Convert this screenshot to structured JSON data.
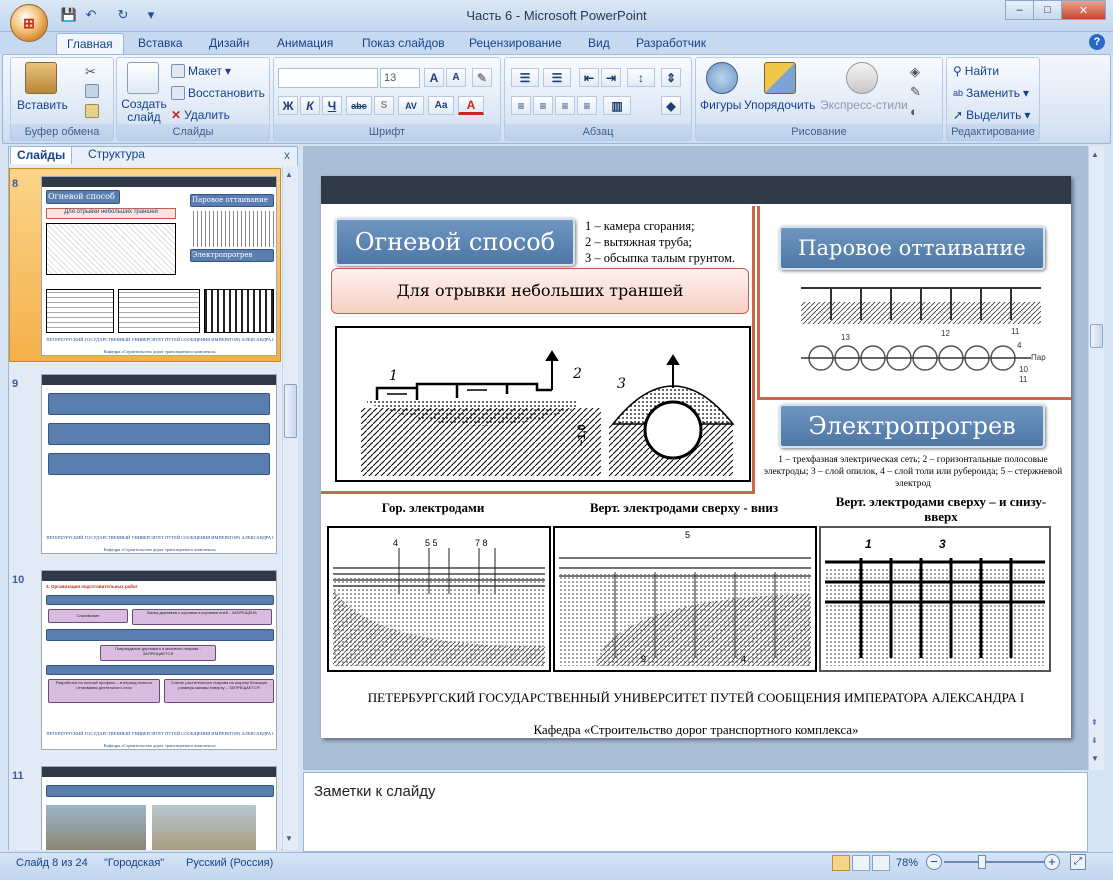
{
  "window": {
    "title": "Часть 6 - Microsoft PowerPoint",
    "min": "–",
    "max": "□",
    "close": "✕"
  },
  "qat": {
    "save": "💾",
    "undo": "↶",
    "redo": "↻",
    "more": "▾"
  },
  "tabs": [
    "Главная",
    "Вставка",
    "Дизайн",
    "Анимация",
    "Показ слайдов",
    "Рецензирование",
    "Вид",
    "Разработчик"
  ],
  "help": "?",
  "ribbon": {
    "clipboard": {
      "label": "Буфер обмена",
      "paste": "Вставить"
    },
    "slides": {
      "label": "Слайды",
      "new": "Создать слайд",
      "layout": "Макет",
      "reset": "Восстановить",
      "delete": "Удалить"
    },
    "font": {
      "label": "Шрифт",
      "size": "13",
      "bold": "Ж",
      "italic": "К",
      "underline": "Ч",
      "strike": "abc",
      "spacing": "AV",
      "case": "Aa"
    },
    "paragraph": {
      "label": "Абзац"
    },
    "drawing": {
      "label": "Рисование",
      "shapes": "Фигуры",
      "arrange": "Упорядочить",
      "quick_styles": "Экспресс-стили"
    },
    "editing": {
      "label": "Редактирование",
      "find": "Найти",
      "replace": "Заменить",
      "select": "Выделить"
    }
  },
  "panel": {
    "tab_slides": "Слайды",
    "tab_outline": "Структура",
    "close": "x"
  },
  "thumbnails": [
    {
      "num": "8"
    },
    {
      "num": "9"
    },
    {
      "num": "10",
      "title": "3. Организация подготовительных работ",
      "pink1": "Спиливание",
      "pink2": "Валка деревьев с корнями и корчевка пней - ЗАПРЕЩЕНА",
      "pink3": "Повреждение дернового и мохового покрова - ЗАПРЕЩАЕТСЯ",
      "pink4": "Разработка на полный профиль – в период полного оттаивания деятельного слоя",
      "pink5": "Снятие растительного покрова на ширину большую размера канавы поверху – ЗАПРЕЩАЕТСЯ"
    },
    {
      "num": "11"
    }
  ],
  "slide": {
    "title_fire": "Огневой способ",
    "fire_legend": [
      "1 – камера сгорания;",
      "2 – вытяжная труба;",
      "3 – обсыпка талым грунтом."
    ],
    "subtitle": "Для отрывки небольших траншей",
    "title_steam": "Паровое оттаивание",
    "title_electric": "Электропрогрев",
    "electric_legend": "1 – трехфазная электрическая сеть; 2 – горизонтальные полосовые электроды; 3 – слой опилок, 4 – слой толи или рубероида; 5 – стержневой электрод",
    "cap1": "Гор. электродами",
    "cap2": "Верт. электродами сверху - вниз",
    "cap3": "Верт. электродами сверху – и снизу-вверх",
    "footer1": "ПЕТЕРБУРГСКИЙ ГОСУДАРСТВЕННЫЙ УНИВЕРСИТЕТ ПУТЕЙ СООБЩЕНИЯ ИМПЕРАТОРА АЛЕКСАНДРА I",
    "footer2": "Кафедра «Строительство дорог транспортного комплекса»",
    "fire_labels": [
      "1",
      "2",
      "3"
    ],
    "steam_labels": [
      "13",
      "12",
      "11",
      "4",
      "Пар",
      "10",
      "11"
    ],
    "el_labels_a": [
      "4",
      "5 5",
      "7 8"
    ],
    "el_labels_b": [
      "5",
      "9",
      "4"
    ],
    "el_labels_c": [
      "1",
      "3"
    ],
    "dim": "~1,0"
  },
  "notes": "Заметки к слайду",
  "status": {
    "slide": "Слайд 8 из 24",
    "theme": "\"Городская\"",
    "lang": "Русский (Россия)",
    "zoom": "78%"
  }
}
